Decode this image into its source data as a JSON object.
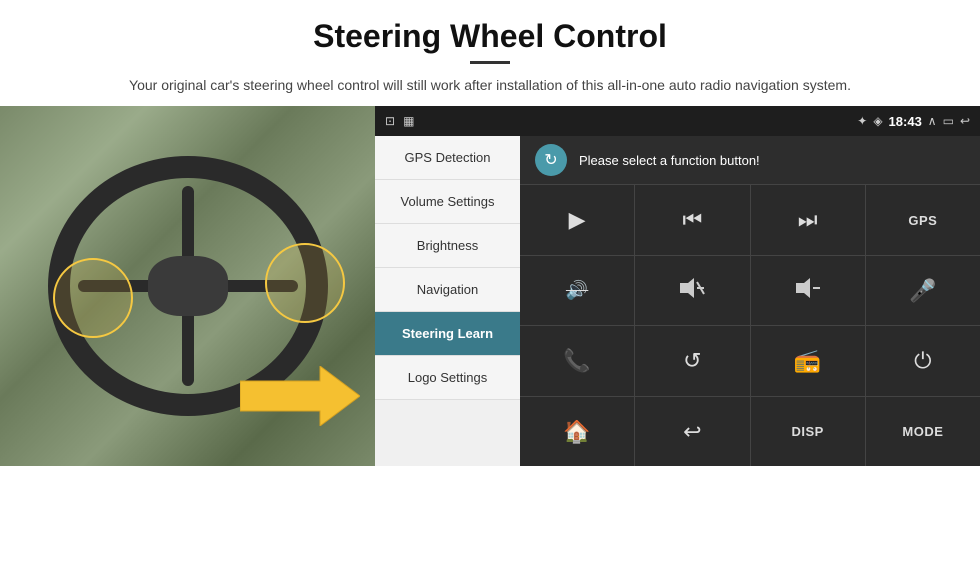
{
  "header": {
    "title": "Steering Wheel Control",
    "subtitle": "Your original car's steering wheel control will still work after installation of this all-in-one auto radio navigation system."
  },
  "status_bar": {
    "time": "18:43",
    "icons": [
      "⊡",
      "✦",
      "🔵",
      "∧",
      "▭",
      "↩"
    ]
  },
  "menu": {
    "items": [
      {
        "label": "GPS Detection",
        "active": false
      },
      {
        "label": "Volume Settings",
        "active": false
      },
      {
        "label": "Brightness",
        "active": false
      },
      {
        "label": "Navigation",
        "active": false
      },
      {
        "label": "Steering Learn",
        "active": true
      },
      {
        "label": "Logo Settings",
        "active": false
      }
    ]
  },
  "panel": {
    "header_text": "Please select a function button!",
    "refresh_icon": "↻",
    "functions": [
      {
        "type": "icon",
        "icon": "▶",
        "label": ""
      },
      {
        "type": "icon",
        "icon": "⏮",
        "label": ""
      },
      {
        "type": "icon",
        "icon": "⏭",
        "label": ""
      },
      {
        "type": "text",
        "icon": "",
        "label": "GPS"
      },
      {
        "type": "icon",
        "icon": "🚫",
        "label": ""
      },
      {
        "type": "icon",
        "icon": "🔊+",
        "label": ""
      },
      {
        "type": "icon",
        "icon": "🔊-",
        "label": ""
      },
      {
        "type": "icon",
        "icon": "🎤",
        "label": ""
      },
      {
        "type": "icon",
        "icon": "📞",
        "label": ""
      },
      {
        "type": "icon",
        "icon": "↺",
        "label": ""
      },
      {
        "type": "icon",
        "icon": "📻",
        "label": ""
      },
      {
        "type": "icon",
        "icon": "⏻",
        "label": ""
      },
      {
        "type": "icon",
        "icon": "🏠",
        "label": ""
      },
      {
        "type": "icon",
        "icon": "↩",
        "label": ""
      },
      {
        "type": "text",
        "icon": "",
        "label": "DISP"
      },
      {
        "type": "text",
        "icon": "",
        "label": "MODE"
      }
    ]
  }
}
